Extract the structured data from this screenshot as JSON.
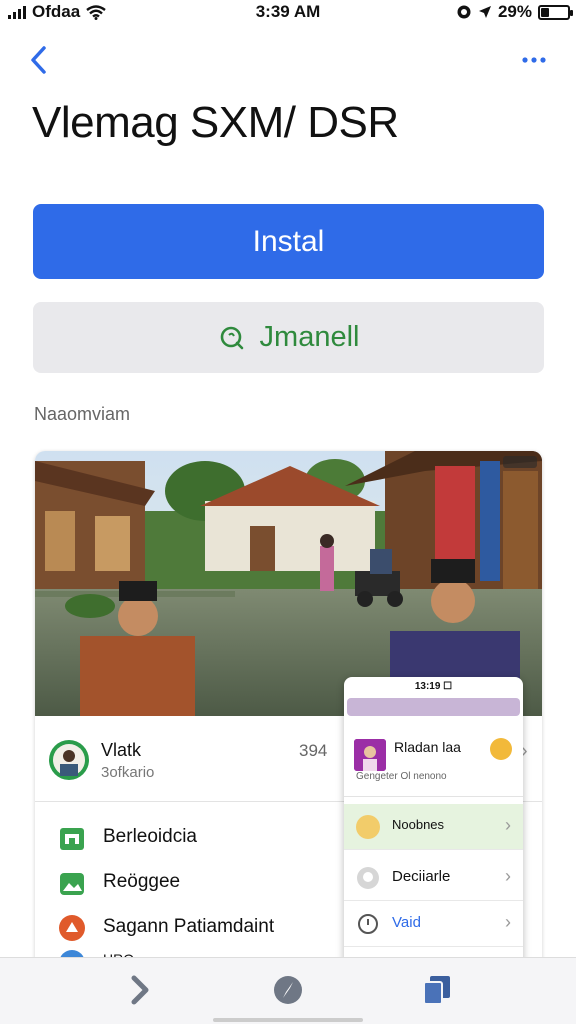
{
  "status_bar": {
    "carrier": "Ofdaa",
    "time": "3:39 AM",
    "battery_pct": "29%",
    "battery_level": 0.29
  },
  "nav": {
    "back_icon": "chevron-left-icon",
    "more_icon": "more-horizontal-icon"
  },
  "app": {
    "title": "Vlemag SXM/ DSR",
    "install_label": "Instal",
    "secondary_label": "Jmanell",
    "secondary_icon": "search-icon",
    "section_label": "Naaomviam"
  },
  "colors": {
    "primary": "#2f6be8",
    "secondary_bg": "#e9e9ec",
    "secondary_text": "#2f8a3d"
  },
  "preview": {
    "status_icon": "wifi-icon",
    "list": {
      "contact_name": "Vlatk",
      "contact_sub": "3ofkario",
      "contact_value": "394",
      "menu": [
        {
          "label": "Berleoidcia",
          "icon": "shop-icon",
          "color": "#3aa34f"
        },
        {
          "label": "Reöggee",
          "icon": "image-icon",
          "color": "#3aa34f"
        },
        {
          "label": "Sagann Patiamdaint",
          "icon": "badge-icon",
          "color": "#e05a2b"
        },
        {
          "label": "HRO",
          "icon": "globe-icon",
          "color": "#3d87d8"
        }
      ]
    },
    "popup": {
      "status_time": "13:19 ☐",
      "header_name": "Rladan laa",
      "header_sub": "Gengeter  Ol nenono",
      "items": [
        {
          "label": "Noobnes",
          "icon": "smile-icon",
          "highlight": true
        },
        {
          "label": "Deciiarle",
          "icon": "chat-icon",
          "highlight": false
        },
        {
          "label": "Vaid",
          "icon": "info-icon",
          "highlight": false
        }
      ]
    }
  },
  "tabbar": {
    "tabs": [
      {
        "name": "forward-icon"
      },
      {
        "name": "compass-icon"
      },
      {
        "name": "copy-icon"
      }
    ]
  }
}
